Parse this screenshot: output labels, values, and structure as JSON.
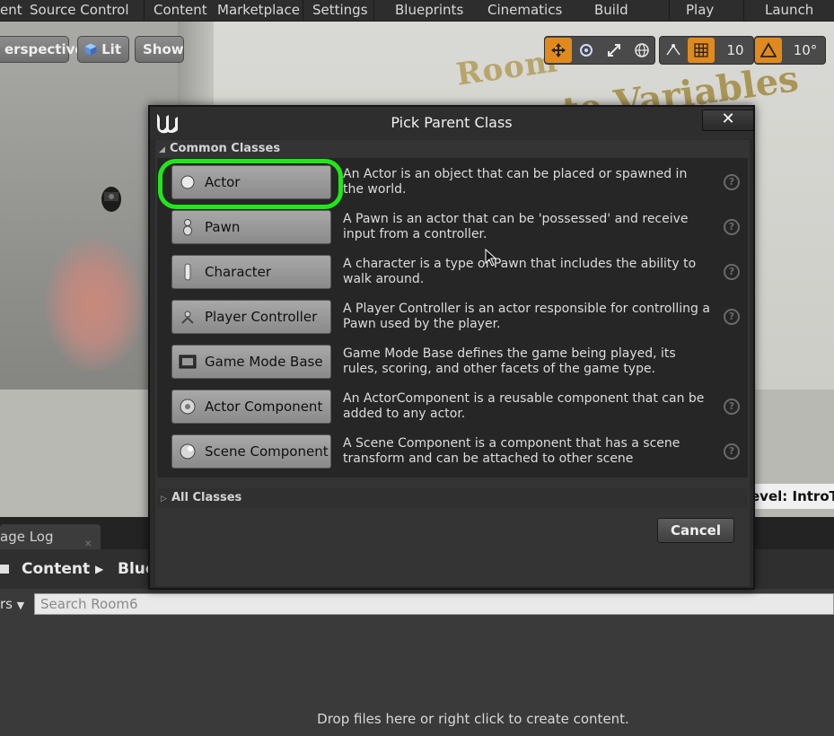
{
  "toolbar": {
    "items": [
      "ent",
      "Source Control",
      "Content",
      "Marketplace",
      "Settings",
      "Blueprints",
      "Cinematics",
      "Build",
      "Play",
      "Launch"
    ]
  },
  "viewport": {
    "perspective_label": "erspective",
    "lit_label": "Lit",
    "show_label": "Show",
    "grid_snap_value": "10",
    "rotation_snap_value": "10°",
    "scene_text_1": "Room",
    "scene_text_2": "ate Variables",
    "level_label": "evel:  IntroTo"
  },
  "modal": {
    "title": "Pick Parent Class",
    "close_label": "✕",
    "common_classes_header": "Common Classes",
    "all_classes_header": "All Classes",
    "cancel_label": "Cancel",
    "classes": [
      {
        "label": "Actor",
        "icon": "actor-sphere-icon",
        "description": "An Actor is an object that can be placed or spawned in the world."
      },
      {
        "label": "Pawn",
        "icon": "pawn-icon",
        "description": "A Pawn is an actor that can be 'possessed' and receive input from a controller."
      },
      {
        "label": "Character",
        "icon": "character-icon",
        "description": "A character is a type of Pawn that includes the ability to walk around."
      },
      {
        "label": "Player Controller",
        "icon": "player-controller-icon",
        "description": "A Player Controller is an actor responsible for controlling a Pawn used by the player."
      },
      {
        "label": "Game Mode Base",
        "icon": "game-mode-icon",
        "description": "Game Mode Base defines the game being played, its rules, scoring, and other facets of the game type."
      },
      {
        "label": "Actor Component",
        "icon": "actor-component-icon",
        "description": "An ActorComponent is a reusable component that can be added to any actor."
      },
      {
        "label": "Scene Component",
        "icon": "scene-component-icon",
        "description": "A Scene Component is a component that has a scene transform and can be attached to other scene"
      }
    ]
  },
  "content_browser": {
    "tab_label": "age Log",
    "path_root": "Content",
    "path_child": "Blue",
    "filter_label": "rs",
    "search_placeholder": "Search Room6",
    "drop_hint": "Drop files here or right click to create content."
  },
  "colors": {
    "highlight_ring": "#22e51b",
    "active_tool": "#e08a1e"
  }
}
